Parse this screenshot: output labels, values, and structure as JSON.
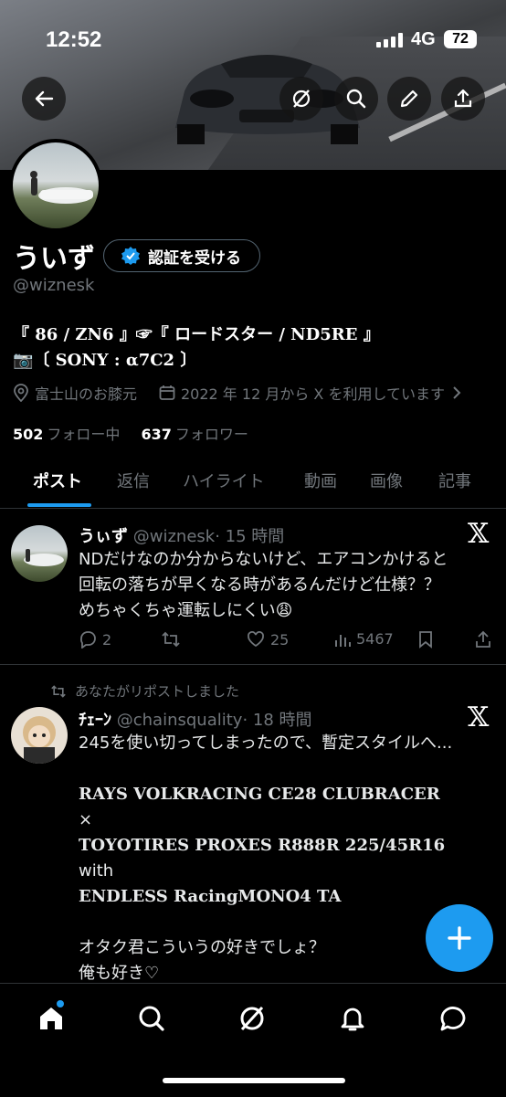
{
  "status": {
    "time": "12:52",
    "network": "4G",
    "battery": "72"
  },
  "profile": {
    "name": "ういず",
    "verify_label": "認証を受ける",
    "handle": "@wiznesk",
    "bio_line1": "『 86 / ZN6 』☞『 ロードスター / ND5RE 』",
    "bio_line2": "📷〔 SONY : α7C2 〕",
    "location": "富士山のお膝元",
    "joined": "2022 年 12 月から X を利用しています",
    "following_count": "502",
    "following_label": "フォロー中",
    "followers_count": "637",
    "followers_label": "フォロワー"
  },
  "tabs": [
    "ポスト",
    "返信",
    "ハイライト",
    "動画",
    "画像",
    "記事"
  ],
  "post1": {
    "name": "うぃず",
    "handle": "@wiznesk",
    "time": "· 15 時間",
    "line1": "NDだけなのか分からないけど、エアコンかけると",
    "line2": "回転の落ちが早くなる時があるんだけど仕様？？",
    "line3": "めちゃくちゃ運転しにくい😩",
    "replies": "2",
    "likes": "25",
    "views": "5467"
  },
  "post2": {
    "repost_note": "あなたがリポストしました",
    "name": "ﾁｪｰﾝ",
    "handle": "@chainsquality",
    "time": "· 18 時間",
    "line1": "245を使い切ってしまったので、暫定スタイルへ...",
    "line2": "RAYS VOLKRACING CE28 CLUBRACER",
    "line3": "×",
    "line4": "TOYOTIRES PROXES R888R 225/45R16",
    "line5": "with",
    "line6": "ENDLESS RacingMONO4 TA",
    "line7": "オタク君こういうの好きでしょ？",
    "line8": "俺も好き♡"
  },
  "icons": [
    "back-arrow-icon",
    "grok-icon",
    "search-icon",
    "edit-icon",
    "share-icon",
    "verified-icon",
    "location-icon",
    "calendar-icon",
    "reply-icon",
    "repost-icon",
    "like-icon",
    "views-icon",
    "bookmark-icon",
    "x-logo-icon",
    "compose-icon",
    "home-icon",
    "explore-icon",
    "notifications-icon",
    "messages-icon"
  ],
  "colors": {
    "accent": "#1d9bf0",
    "muted": "#71767b",
    "background": "#000000"
  }
}
